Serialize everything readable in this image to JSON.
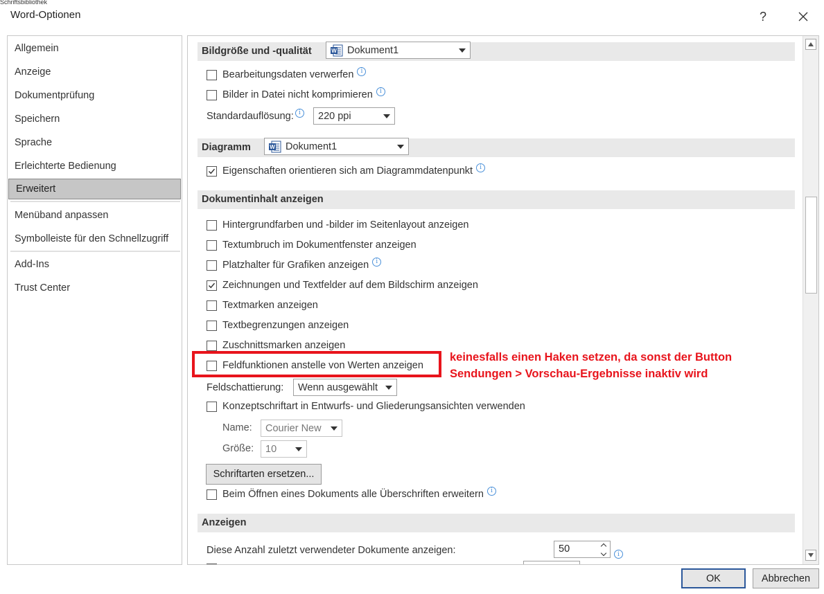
{
  "window": {
    "background_strip_text": "Schriftsbibliothek",
    "title": "Word-Optionen",
    "help_label": "?",
    "close_label": "✕"
  },
  "sidebar": {
    "items": [
      {
        "label": "Allgemein"
      },
      {
        "label": "Anzeige"
      },
      {
        "label": "Dokumentprüfung"
      },
      {
        "label": "Speichern"
      },
      {
        "label": "Sprache"
      },
      {
        "label": "Erleichterte Bedienung"
      },
      {
        "label": "Erweitert",
        "selected": true
      },
      {
        "label": "Menüband anpassen"
      },
      {
        "label": "Symbolleiste für den Schnellzugriff"
      },
      {
        "label": "Add-Ins"
      },
      {
        "label": "Trust Center"
      }
    ]
  },
  "image_section": {
    "title": "Bildgröße und -qualität",
    "document_select": "Dokument1",
    "discard_edit_data": {
      "label": "Bearbeitungsdaten verwerfen",
      "checked": false
    },
    "no_compress": {
      "label": "Bilder in Datei nicht komprimieren",
      "checked": false
    },
    "resolution_label": "Standardauflösung:",
    "resolution_value": "220 ppi"
  },
  "chart_section": {
    "title": "Diagramm",
    "document_select": "Dokument1",
    "properties_follow": {
      "label": "Eigenschaften orientieren sich am Diagrammdatenpunkt",
      "checked": true
    }
  },
  "doc_content_section": {
    "title": "Dokumentinhalt anzeigen",
    "options": [
      {
        "label": "Hintergrundfarben und -bilder im Seitenlayout anzeigen",
        "checked": false,
        "info": false
      },
      {
        "label": "Textumbruch im Dokumentfenster anzeigen",
        "checked": false,
        "info": false
      },
      {
        "label": "Platzhalter für Grafiken anzeigen",
        "checked": false,
        "info": true
      },
      {
        "label": "Zeichnungen und Textfelder auf dem Bildschirm anzeigen",
        "checked": true,
        "info": false
      },
      {
        "label": "Textmarken anzeigen",
        "checked": false,
        "info": false
      },
      {
        "label": "Textbegrenzungen anzeigen",
        "checked": false,
        "info": false
      },
      {
        "label": "Zuschnittsmarken anzeigen",
        "checked": false,
        "info": false
      },
      {
        "label": "Feldfunktionen anstelle von Werten anzeigen",
        "checked": false,
        "info": false
      }
    ],
    "field_shading_label": "Feldschattierung:",
    "field_shading_value": "Wenn ausgewählt",
    "draft_font": {
      "label": "Konzeptschriftart in Entwurfs- und Gliederungsansichten verwenden",
      "checked": false
    },
    "name_label": "Name:",
    "name_value": "Courier New",
    "size_label": "Größe:",
    "size_value": "10",
    "replace_fonts_button": "Schriftarten ersetzen...",
    "expand_headings": {
      "label": "Beim Öffnen eines Dokuments alle Überschriften erweitern",
      "checked": false
    }
  },
  "display_section": {
    "title": "Anzeigen",
    "recent_docs_label": "Diese Anzahl zuletzt verwendeter Dokumente anzeigen:",
    "recent_docs_value": "50"
  },
  "annotation": {
    "line1": "keinesfalls einen Haken setzen, da sonst der Button",
    "line2": "Sendungen > Vorschau-Ergebnisse inaktiv wird",
    "color": "#e8141c"
  },
  "buttons": {
    "ok": "OK",
    "cancel": "Abbrechen"
  },
  "colors": {
    "selected_nav": "#c6c6c6",
    "section_header": "#e9e9e9",
    "ok_border": "#2b579a",
    "info_icon": "#4a90d9"
  }
}
